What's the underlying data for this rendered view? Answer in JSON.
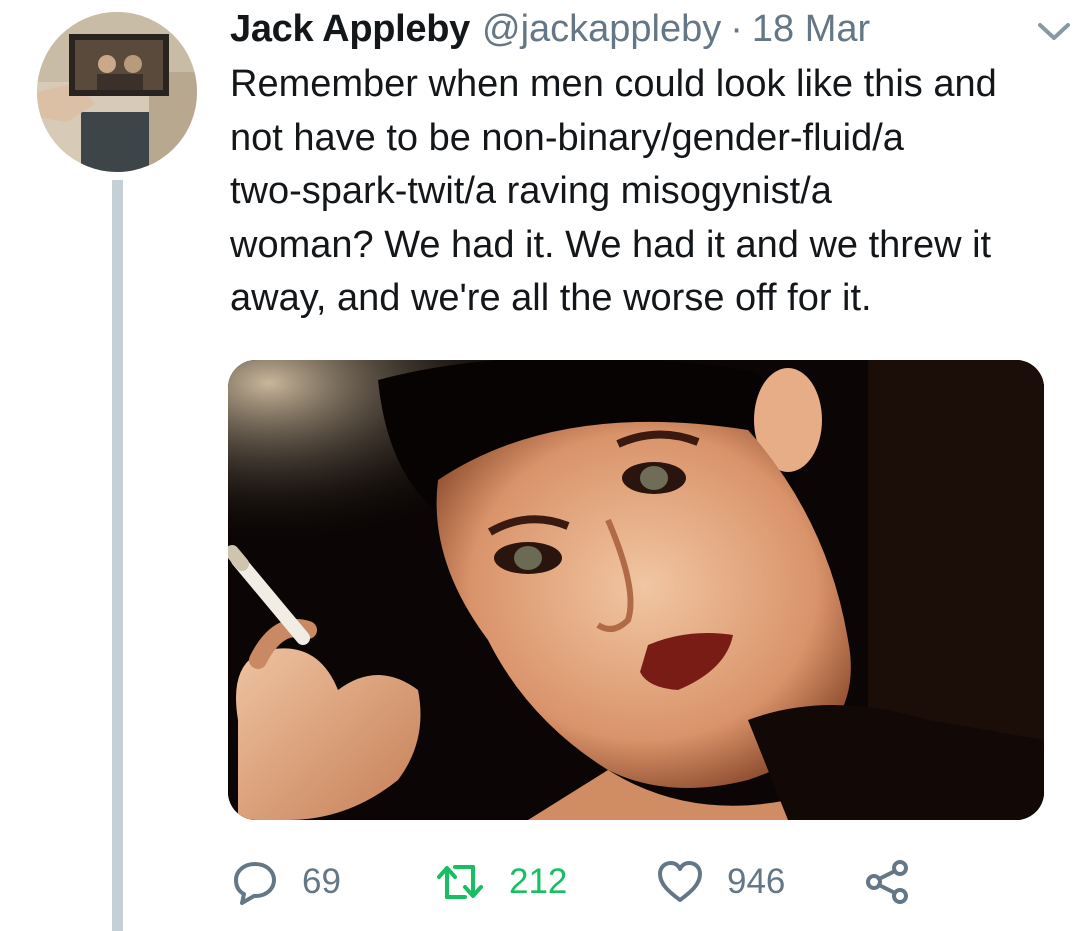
{
  "tweet": {
    "display_name": "Jack Appleby",
    "handle": "@jackappleby",
    "separator": "·",
    "date": "18 Mar",
    "text_lines": [
      "Remember when men could look like this and",
      "not have to be non-binary/gender-fluid/a",
      "two-spark-twit/a raving misogynist/a",
      "woman? We had it. We had it and we threw it",
      "away, and we're all the worse off for it."
    ]
  },
  "actions": {
    "replies": "69",
    "retweets": "212",
    "likes": "946"
  },
  "icons": {
    "avatar": "profile-photo",
    "menu": "chevron-down-icon",
    "reply": "reply-icon",
    "retweet": "retweet-icon",
    "like": "heart-icon",
    "share": "share-icon"
  },
  "colors": {
    "text": "#14171a",
    "secondary": "#657786",
    "retweet_active": "#17bf63",
    "thread_line": "#c4cfd6"
  }
}
